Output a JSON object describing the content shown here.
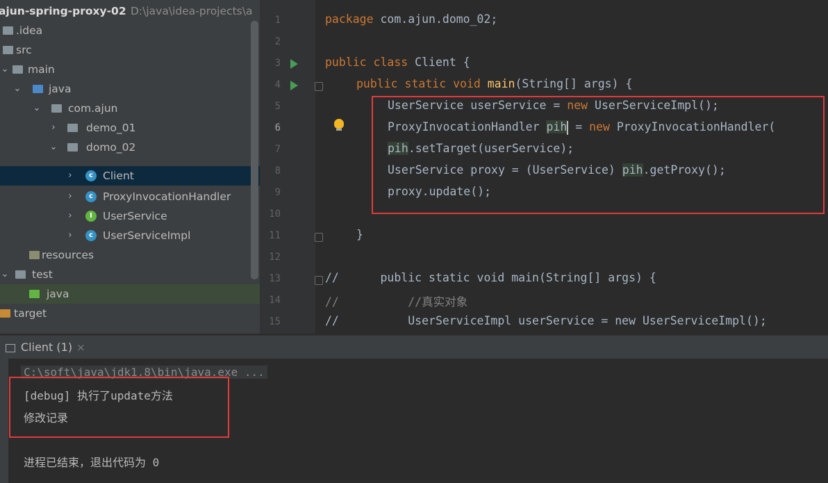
{
  "project_tree": {
    "root": {
      "name": "ajun-spring-proxy-02",
      "path": "D:\\java\\idea-projects\\a"
    },
    "items": [
      {
        "label": ".idea",
        "kind": "folder"
      },
      {
        "label": "src",
        "kind": "folder"
      },
      {
        "label": "main",
        "kind": "folder"
      },
      {
        "label": "java",
        "kind": "source-folder"
      },
      {
        "label": "com.ajun",
        "kind": "package"
      },
      {
        "label": "demo_01",
        "kind": "package"
      },
      {
        "label": "domo_02",
        "kind": "package"
      },
      {
        "label": "Client",
        "kind": "class",
        "selected": true
      },
      {
        "label": "ProxyInvocationHandler",
        "kind": "class"
      },
      {
        "label": "UserService",
        "kind": "interface"
      },
      {
        "label": "UserServiceImpl",
        "kind": "class"
      },
      {
        "label": "resources",
        "kind": "resources-folder"
      },
      {
        "label": "test",
        "kind": "folder"
      },
      {
        "label": "java",
        "kind": "test-source-folder"
      },
      {
        "label": "target",
        "kind": "excluded-folder"
      }
    ]
  },
  "editor": {
    "line_numbers": [
      "1",
      "2",
      "3",
      "4",
      "5",
      "6",
      "7",
      "8",
      "9",
      "10",
      "11",
      "12",
      "13",
      "14",
      "15"
    ],
    "current_line": "6",
    "lines": {
      "l1": {
        "kw": "package",
        "rest": " com.ajun.domo_02;"
      },
      "l3": {
        "kw": "public class",
        "rest": " Client {"
      },
      "l4": {
        "kw": "public static void",
        "fn": "main",
        "rest": "(String[] args) {"
      },
      "l5": {
        "a": "UserService userService = ",
        "kw": "new",
        "b": " UserServiceImpl();"
      },
      "l6": {
        "a": "ProxyInvocationHandler ",
        "var": "pih",
        "b": " = ",
        "kw": "new",
        "c": " ProxyInvocationHandler("
      },
      "l7": {
        "var": "pih",
        "a": ".setTarget(userService);"
      },
      "l8": {
        "a": "UserService proxy = (UserService) ",
        "var": "pih",
        "b": ".getProxy();"
      },
      "l9": {
        "a": "proxy.update();"
      },
      "l11": {
        "a": "}"
      },
      "l13": {
        "a": "//      public static void main(String[] args) {"
      },
      "l14": {
        "a": "//          //真实对象"
      },
      "l15": {
        "a": "//          UserServiceImpl userService = new UserServiceImpl();"
      }
    }
  },
  "run_panel": {
    "tab_label": "Client (1)",
    "close_symbol": "×",
    "command": "C:\\soft\\java\\jdk1.8\\bin\\java.exe ...",
    "output": [
      "[debug] 执行了update方法",
      "修改记录"
    ],
    "exit_message": "进程已结束，退出代码为 0"
  },
  "colors": {
    "highlight_box": "#e03c3c",
    "selection": "#0d293e",
    "keyword": "#cc7832",
    "method": "#ffc66d"
  }
}
